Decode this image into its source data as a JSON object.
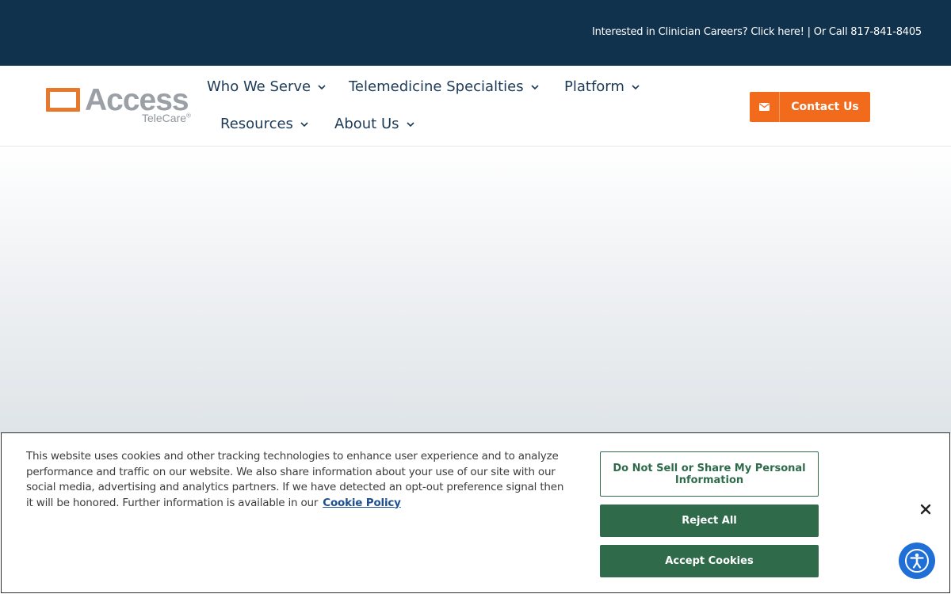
{
  "topbar": {
    "text": "Interested in Clinician Careers? Click here! | Or Call 817-841-8405"
  },
  "logo": {
    "word": "Access",
    "sub": "TeleCare",
    "mark": "®"
  },
  "nav": {
    "items": [
      {
        "label": "Who We Serve"
      },
      {
        "label": "Telemedicine Specialties"
      },
      {
        "label": "Platform"
      },
      {
        "label": "Resources"
      },
      {
        "label": "About Us"
      }
    ]
  },
  "contact_button": {
    "label": "Contact Us",
    "icon": "envelope-icon"
  },
  "cookie_banner": {
    "text": "This website uses cookies and other tracking technologies to enhance user experience and to analyze performance and traffic on our website. We also share information about your use of our site with our social media, advertising and analytics partners. If we have detected an opt-out preference signal then it will be honored. Further information is available in our",
    "link_text": "Cookie Policy",
    "do_not_sell_label": "Do Not Sell or Share My Personal Information",
    "reject_label": "Reject All",
    "accept_label": "Accept Cookies",
    "close_icon": "close-icon"
  },
  "accessibility": {
    "icon": "accessibility-icon"
  },
  "colors": {
    "topbar": "#11324d",
    "accent_orange": "#f26b1d",
    "nav_text": "#1c3a57",
    "cookie_green": "#2f6b4a",
    "a11y_blue": "#1f6fd6"
  }
}
